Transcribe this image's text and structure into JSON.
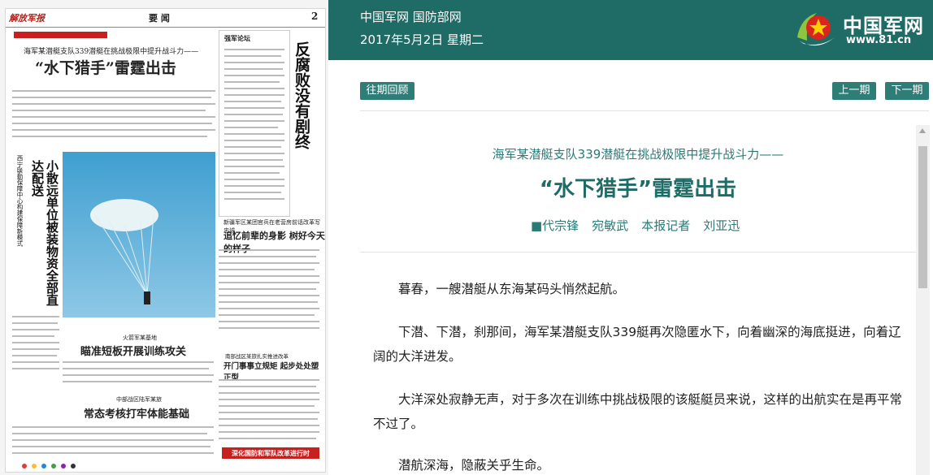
{
  "header": {
    "site_name": "中国军网 国防部网",
    "date": "2017年5月2日 星期二",
    "logo_text": "中国军网",
    "logo_url": "www.81.cn"
  },
  "nav": {
    "archive_label": "往期回顾",
    "prev_label": "上一期",
    "next_label": "下一期"
  },
  "newspaper": {
    "masthead": "解放军报",
    "section": "要 闻",
    "page_no": "2",
    "lead_kicker": "海军某潜艇支队339潜艇在挑战极限中提升战斗力——",
    "lead_title": "“水下猎手”雷霆出击",
    "side_title": "反腐败没有剧终",
    "side_box_label": "强军论坛",
    "vert_headline": "小散远单位被装物资全部直达配送",
    "vert_sub": "西宁联勤保障中心构建保障新模式",
    "mid_kicker": "新疆军区某团官兵在老营房前话改革写忠诚",
    "mid_title": "追忆前辈的身影 树好今天的样子",
    "story2_kicker": "火箭军某基地",
    "story2_title": "瞄准短板开展训练攻关",
    "story3_kicker": "南部战区某旅扎实推进改革",
    "story3_title": "开门事事立规矩 起步处处塑正型",
    "story4_kicker": "中部战区陆军某旅",
    "story4_title": "常态考核打牢体能基础",
    "footer_banner": "深化国防和军队改革进行时"
  },
  "article": {
    "kicker": "海军某潜艇支队339潜艇在挑战极限中提升战斗力——",
    "title": "“水下猎手”雷霆出击",
    "bylines": [
      "■代宗锋",
      "宛敏武",
      "本报记者",
      "刘亚迅"
    ],
    "paragraphs": [
      "暮春，一艘潜艇从东海某码头悄然起航。",
      "下潜、下潜，刹那间，海军某潜艇支队339艇再次隐匿水下，向着幽深的海底挺进，向着辽阔的大洋进发。",
      "大洋深处寂静无声，对于多次在训练中挑战极限的该艇艇员来说，这样的出航实在是再平常不过了。",
      "潜航深海，隐蔽关乎生命。"
    ]
  },
  "colors": {
    "header_bg": "#1f6b66",
    "button_bg": "#2f7d77",
    "kicker": "#2a7a76",
    "title": "#1f6b66",
    "banner_red": "#c8201f"
  },
  "icons": {
    "logo": "army-star-logo-icon",
    "scroll_up": "scroll-up-arrow-icon"
  }
}
